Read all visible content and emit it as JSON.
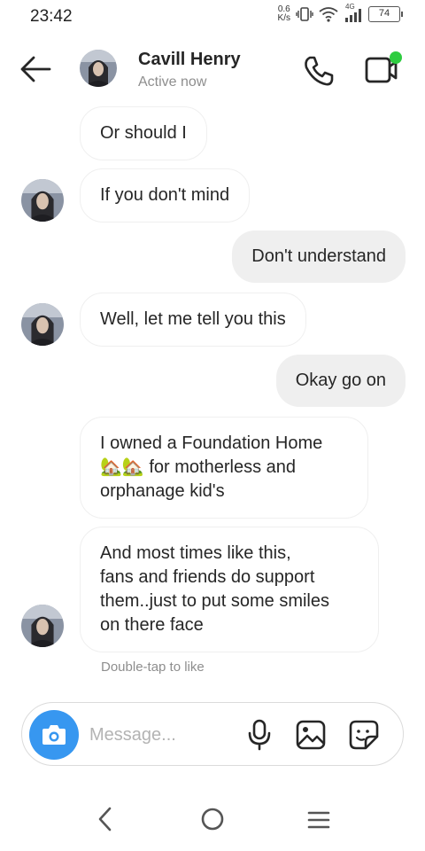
{
  "status_bar": {
    "time": "23:42",
    "net_speed_value": "0.6",
    "net_speed_unit": "K/s",
    "network": "4G",
    "battery": "74"
  },
  "header": {
    "contact_name": "Cavill Henry",
    "contact_status": "Active now",
    "online_dot_color": "#2ecc40"
  },
  "messages": [
    {
      "direction": "incoming",
      "text": "Or should I",
      "avatar": false
    },
    {
      "direction": "incoming",
      "text": "If you don't mind",
      "avatar": true
    },
    {
      "direction": "outgoing",
      "text": "Don't understand"
    },
    {
      "direction": "incoming",
      "text": "Well, let me tell you this",
      "avatar": true
    },
    {
      "direction": "outgoing",
      "text": "Okay go on"
    },
    {
      "direction": "incoming",
      "lines": [
        "I owned a Foundation Home",
        "🏡🏡 for motherless and",
        "orphanage kid's"
      ],
      "avatar": false
    },
    {
      "direction": "incoming",
      "lines": [
        "And most times like this,",
        "fans and friends do support",
        "them..just to put some smiles",
        "on there face"
      ],
      "avatar": true
    }
  ],
  "hint": "Double-tap to like",
  "composer": {
    "placeholder": "Message...",
    "camera_color": "#3797f0"
  }
}
